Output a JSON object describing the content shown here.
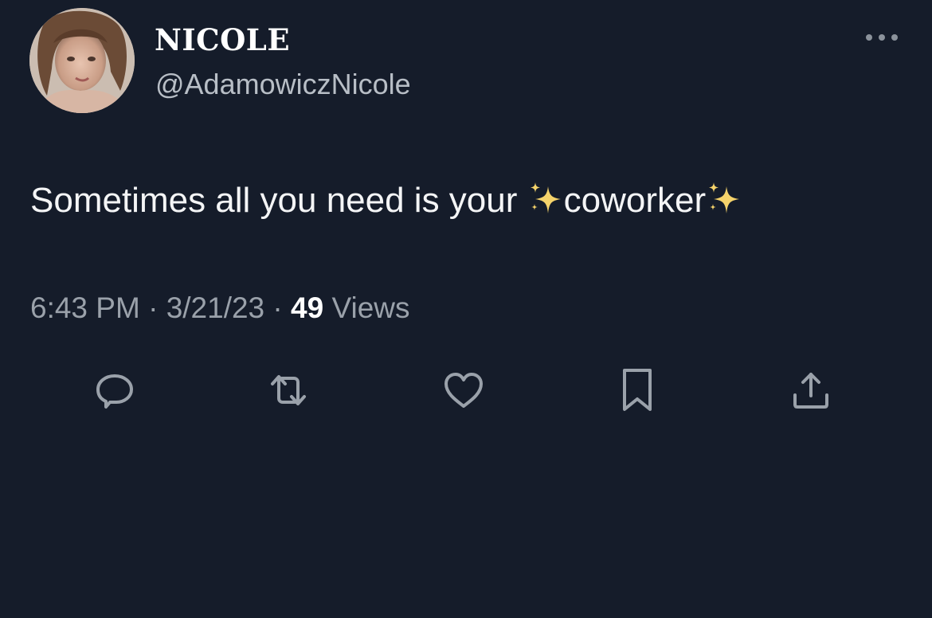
{
  "author": {
    "display_name": "NICOLE",
    "handle": "@AdamowiczNicole"
  },
  "tweet": {
    "text_before": "Sometimes all you need is your ",
    "emphasized_word": "coworker",
    "sparkle_icon": "sparkles-emoji"
  },
  "meta": {
    "time": "6:43 PM",
    "separator_1": " · ",
    "date": "3/21/23",
    "separator_2": " · ",
    "views_count": "49",
    "views_label": " Views"
  },
  "actions": {
    "reply_icon": "speech-bubble-icon",
    "retweet_icon": "retweet-arrows-icon",
    "like_icon": "heart-icon",
    "bookmark_icon": "bookmark-icon",
    "share_icon": "share-upload-icon"
  },
  "colors": {
    "background": "#151c2a",
    "text_primary": "#f4f5f6",
    "text_secondary": "#9aa1aa",
    "icon": "#9aa1aa",
    "sparkle": "#f5d36b"
  }
}
